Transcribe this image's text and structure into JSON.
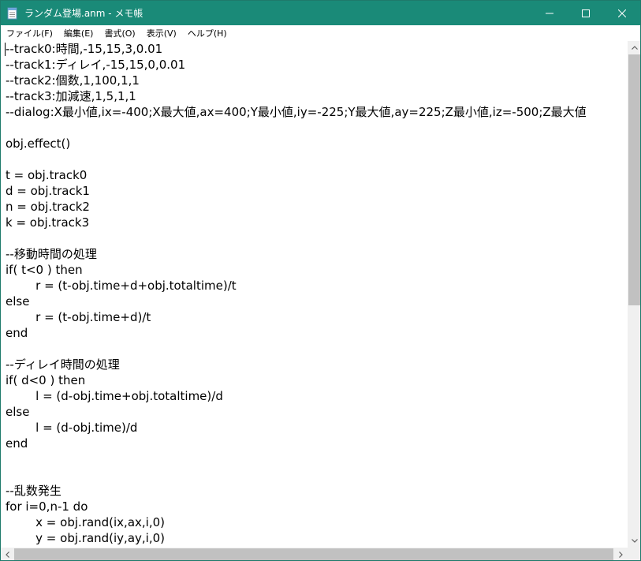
{
  "window": {
    "title": "ランダム登場.anm - メモ帳",
    "accent_color": "#1a8a78",
    "icon": "notepad-icon"
  },
  "controls": {
    "minimize_icon": "minimize-icon",
    "maximize_icon": "maximize-icon",
    "close_icon": "close-icon"
  },
  "menu": [
    {
      "label": "ファイル(F)"
    },
    {
      "label": "編集(E)"
    },
    {
      "label": "書式(O)"
    },
    {
      "label": "表示(V)"
    },
    {
      "label": "ヘルプ(H)"
    }
  ],
  "editor": {
    "lines": [
      "--track0:時間,-15,15,3,0.01",
      "--track1:ディレイ,-15,15,0,0.01",
      "--track2:個数,1,100,1,1",
      "--track3:加減速,1,5,1,1",
      "--dialog:X最小値,ix=-400;X最大値,ax=400;Y最小値,iy=-225;Y最大値,ay=225;Z最小値,iz=-500;Z最大値",
      "",
      "obj.effect()",
      "",
      "t = obj.track0",
      "d = obj.track1",
      "n = obj.track2",
      "k = obj.track3",
      "",
      "--移動時間の処理",
      "if( t<0 ) then",
      "\t\tr = (t-obj.time+d+obj.totaltime)/t",
      "else",
      "\t\tr = (t-obj.time+d)/t",
      "end",
      "",
      "--ディレイ時間の処理",
      "if( d<0 ) then",
      "\t\tl = (d-obj.time+obj.totaltime)/d",
      "else",
      "\t\tl = (d-obj.time)/d",
      "end",
      "",
      "",
      "--乱数発生",
      "for i=0,n-1 do",
      "\t\tx = obj.rand(ix,ax,i,0)",
      "\t\ty = obj.rand(iy,ay,i,0)"
    ]
  },
  "scrollbars": {
    "vertical_up_icon": "scroll-up-arrow-icon",
    "vertical_down_icon": "scroll-down-arrow-icon",
    "horizontal_left_icon": "scroll-left-arrow-icon",
    "horizontal_right_icon": "scroll-right-arrow-icon"
  }
}
